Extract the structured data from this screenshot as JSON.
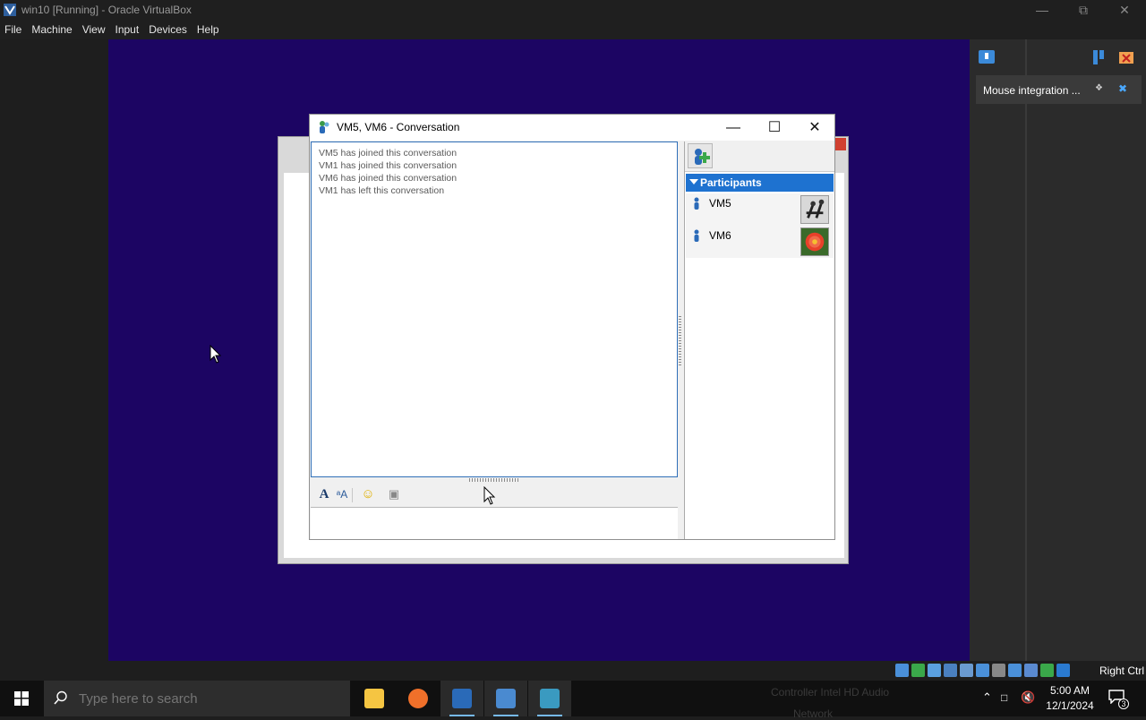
{
  "host": {
    "window_title": "win10 [Running] - Oracle VirtualBox",
    "menu": [
      "File",
      "Machine",
      "View",
      "Input",
      "Devices",
      "Help"
    ],
    "notification": "Mouse integration ...",
    "status_host_key": "Right Ctrl"
  },
  "conversation": {
    "title": "VM5, VM6 - Conversation",
    "log": [
      "VM5 has joined this conversation",
      "VM1 has joined this conversation",
      "VM6 has joined this conversation",
      "VM1 has left this conversation"
    ],
    "compose_value": "",
    "participants_label": "Participants",
    "participants": [
      {
        "name": "VM5",
        "avatar": "chess-pieces-avatar"
      },
      {
        "name": "VM6",
        "avatar": "flower-avatar"
      }
    ]
  },
  "taskbar": {
    "search_placeholder": "Type here to search",
    "apps": [
      "file-explorer",
      "firefox",
      "visual-studio",
      "app-10",
      "messenger"
    ],
    "tray_ghost_line1": "Controller    Intel HD Audio",
    "tray_ghost_line2": "Network",
    "time": "5:00 AM",
    "date": "12/1/2024",
    "notification_count": "3"
  },
  "colors": {
    "guest_background": "#1c0563",
    "participants_header": "#1e72d0",
    "selection_border": "#2f6fb8"
  }
}
